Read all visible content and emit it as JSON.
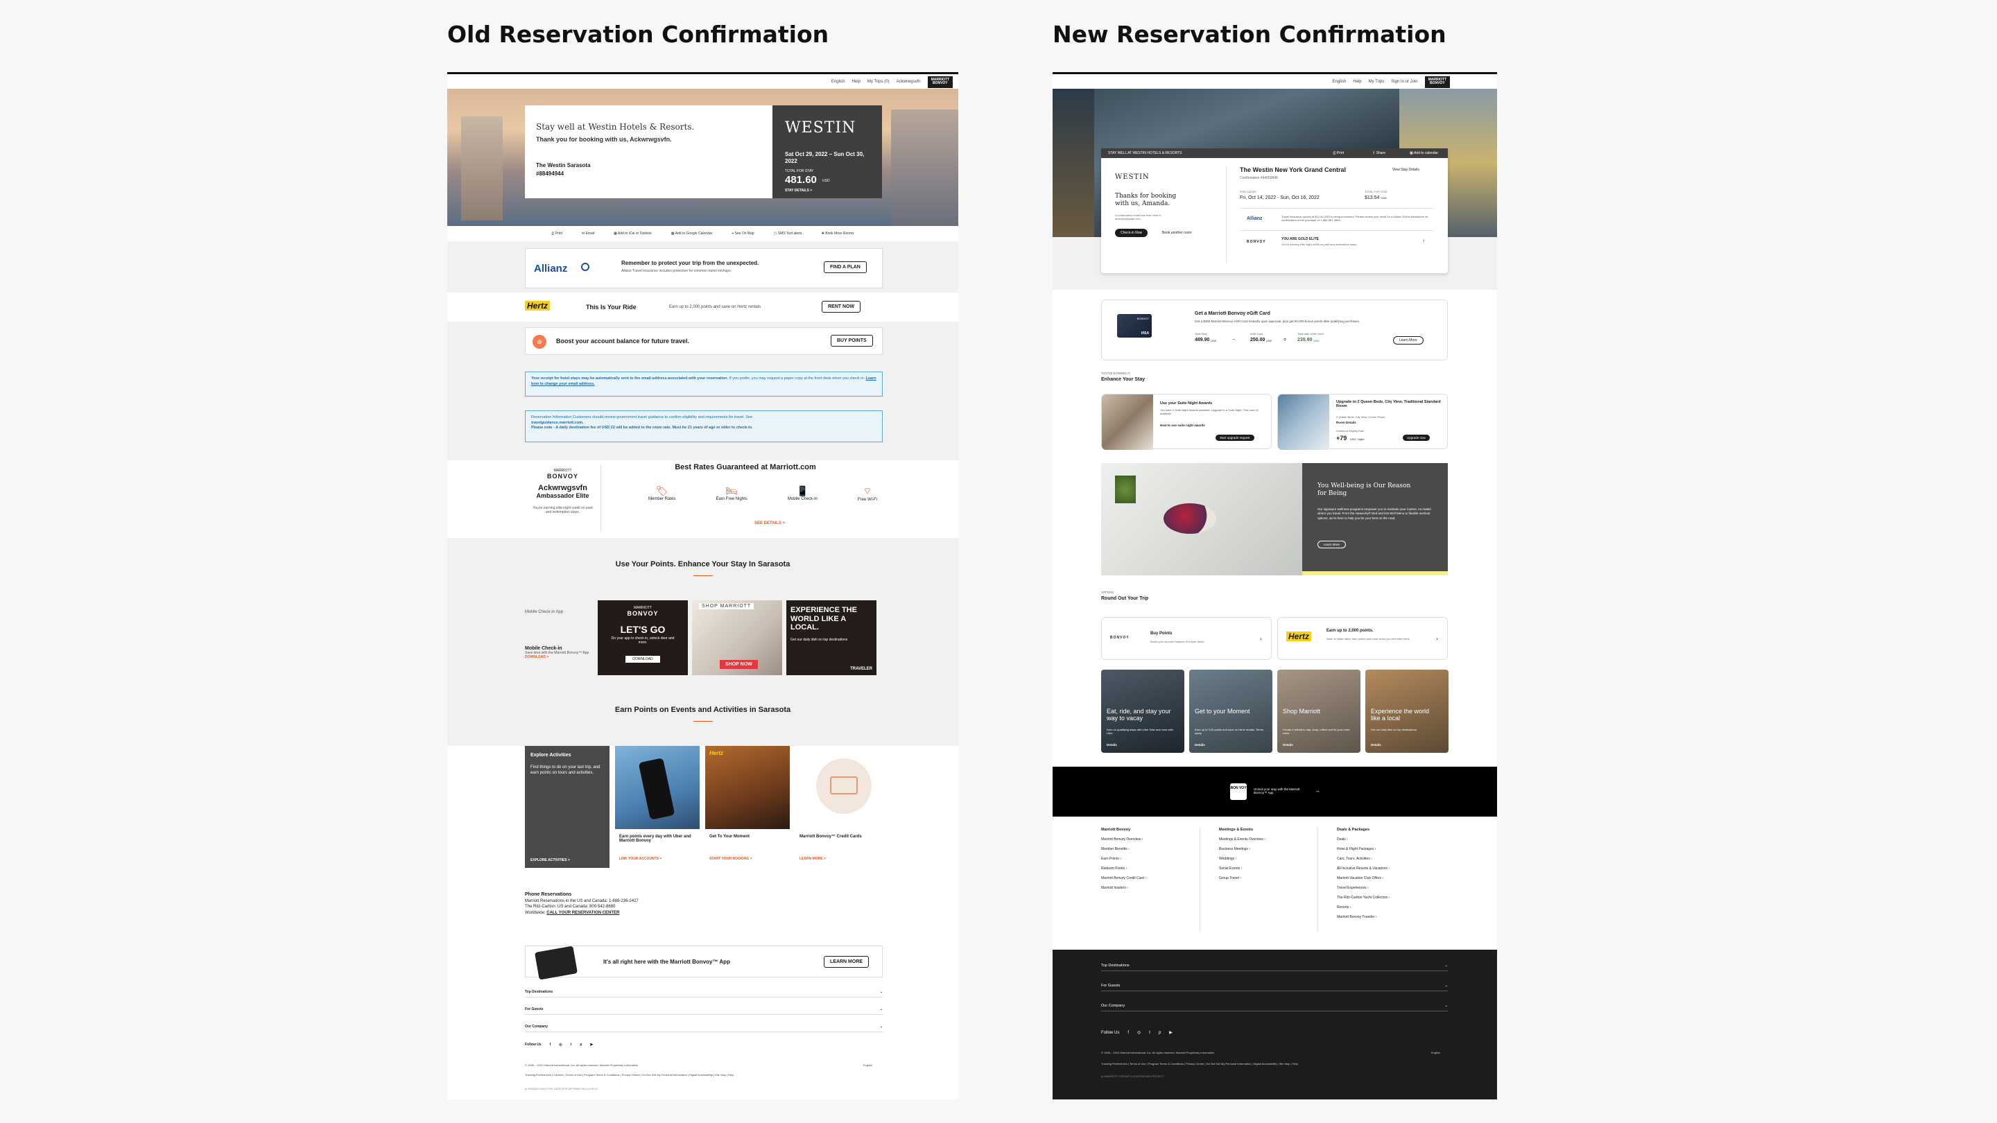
{
  "old": {
    "title": "Old Reservation Confirmation",
    "nav": {
      "items": [
        "English",
        "Help",
        "My Trips (0)",
        "Ackwrwgsvfn"
      ],
      "brand_top": "MARRIOTT",
      "brand": "BONVOY"
    },
    "hero": {
      "headline": "Stay well at Westin Hotels & Resorts.",
      "thanks": "Thank you for booking with us, Ackwrwgsvfn.",
      "hotel": "The Westin Sarasota",
      "confirmation": "#88494944",
      "logo": "WESTIN",
      "dates": "Sat Oct 29, 2022 – Sun Oct 30, 2022",
      "total_label": "TOTAL FOR STAY",
      "total": "481.60",
      "currency": "USD",
      "details_link": "STAY DETAILS >"
    },
    "actions": [
      "Print",
      "Email",
      "Add to iCal or Outlook",
      "Add to Google Calendar",
      "See On Map",
      "SMS Text alerts",
      "Book More Rooms"
    ],
    "allianz": {
      "logo": "Allianz",
      "headline": "Remember to protect your trip from the unexpected.",
      "sub": "Allianz Travel Insurance includes protection for common travel mishaps.",
      "button": "FIND A PLAN"
    },
    "hertz": {
      "logo": "Hertz",
      "headline": "This Is Your Ride",
      "sub": "Earn up to 2,000 points and save on Hertz rentals",
      "button": "RENT NOW"
    },
    "boost": {
      "headline": "Boost your account balance for future travel.",
      "button": "BUY POINTS"
    },
    "notice1": {
      "text": "Your receipt for hotel stays may be automatically sent to the email address associated with your reservation.",
      "text2": "If you prefer, you may request a paper copy at the front desk when you check in.",
      "link": "Learn how to change your email address."
    },
    "notice2": {
      "line1": "Reservation Information Customers should review government travel guidance to confirm eligibility and requirements for travel. See",
      "line2": "travelguidance.marriott.com.",
      "line3": "Please note - A daily destination fee of USD 22 will be added to the room rate. Must be 21 years of age or older to check-in."
    },
    "member": {
      "brand_top": "MARRIOTT",
      "brand": "BONVOY",
      "name": "Ackwrwgsvfn",
      "tier": "Ambassador Elite",
      "note": "You're earning elite night credit on paid and redemption stays."
    },
    "rates": {
      "title": "Best Rates Guaranteed at Marriott.com",
      "items": [
        "Member Rates",
        "Earn Free Nights",
        "Mobile Check-in",
        "Free Wi-Fi"
      ],
      "link": "SEE DETAILS >"
    },
    "points_section": {
      "title": "Use Your Points. Enhance Your Stay In Sarasota",
      "mobile_alt": "Mobile Check-in App",
      "mobile_title": "Mobile Check-in",
      "mobile_sub": "Save time with the Marriott Bonvoy™ App",
      "mobile_link": "DOWNLOAD >",
      "tile1_brand_top": "MARRIOTT",
      "tile1_brand": "BONVOY",
      "tile1_headline": "LET'S GO",
      "tile1_sub": "Do your app to check in, unlock door and more.",
      "tile1_btn": "DOWNLOAD",
      "tile2_brand": "SHOP MARRIOTT",
      "tile2_btn": "SHOP NOW",
      "tile3_headline": "EXPERIENCE THE WORLD LIKE A LOCAL.",
      "tile3_sub": "Get our daily dish on top destinations",
      "tile3_brand": "TRAVELER"
    },
    "events": {
      "title": "Earn Points on Events and Activities in Sarasota",
      "explore_title": "Explore Activities",
      "explore_sub": "Find things to do on your last trip, and earn points on tours and activities.",
      "explore_link": "EXPLORE ACTIVITIES >",
      "cards": [
        {
          "title": "Earn points every day with Uber and Marriott Bonvoy",
          "link": "LINK YOUR ACCOUNTS >"
        },
        {
          "title": "Get To Your Moment",
          "link": "START YOUR BOOKING >"
        },
        {
          "title": "Marriott Bonvoy™ Credit Cards",
          "link": "LEARN MORE >"
        }
      ],
      "hertz_logo": "Hertz"
    },
    "phone": {
      "title": "Phone Reservations",
      "line1": "Marriott Reservations in the US and Canada: 1-888-236-2427",
      "line2": "The Ritz-Carlton: US and Canada: 800-542-8680",
      "line3": "Worldwide:",
      "link": "CALL YOUR RESERVATION CENTER"
    },
    "app": {
      "text": "It's all right here with the Marriott Bonvoy™ App",
      "button": "LEARN MORE"
    },
    "footer": {
      "accordions": [
        "Top Destinations",
        "For Guests",
        "Our Company"
      ],
      "follow": "Follow Us",
      "copyright": "© 1996 – 2022 Marriott International, Inc. All rights reserved. Marriott Proprietary Information",
      "lang": "English",
      "links": "Tracking Preferences  |  Careers  |  Terms of Use  |  Program Terms & Conditions  |  Privacy Center  |  Do Not Sell My Personal Information  |  Digital Accessibility  |  Site Map  |  Help",
      "code": "pi-RJEBDCOMVKTHU-DATE-BTR-MSTRMKTMJ-m-PKV-2"
    }
  },
  "new": {
    "title": "New Reservation Confirmation",
    "nav": {
      "items": [
        "English",
        "Help",
        "My Trips",
        "Sign In or Join"
      ],
      "brand_top": "MARRIOTT",
      "brand": "BONVOY"
    },
    "hero": {
      "strip": "STAY WELL AT WESTIN HOTELS & RESORTS",
      "actions": [
        "Print",
        "Share",
        "Add to calendar"
      ],
      "logo": "WESTIN",
      "thanks": "Thanks for booking with us, Amanda.",
      "email_note": "A confirmation email has been sent to amanda@gmail.com",
      "checkin_btn": "Check-in Now",
      "book_btn": "Book another room",
      "hotel": "The Westin New York Grand Central",
      "view_details": "View Stay Details",
      "confirmation": "Confirmation #94659848",
      "dates_label": "STAY DATES",
      "dates": "Fri, Oct 14, 2022 - Sun, Oct 16, 2022",
      "total_label": "TOTAL FOR STAY",
      "total": "$13.54",
      "currency": "USD",
      "allianz": "Allianz",
      "allianz_text": "Travel insurance quoted at $12.40 USD is being processed. Please review your email for a Allianz Global Assistance for confirmation of the purchase or 1-866-587-4884.",
      "bonvoy_brand": "BONVOY",
      "gold_title": "YOU ARE GOLD ELITE",
      "gold_sub": "You're earning elite night credit on paid and redemption stays."
    },
    "egift": {
      "title": "Get a Marriott Bonvoy eGift Card",
      "sub": "Get a $350 Marriott Bonvoy eGift Card instantly upon approval, plus get 60,000 bonus points after qualifying purchases.",
      "total_label": "Total Stay",
      "total": "489.90",
      "card_label": "eGift Card",
      "card": "250.00",
      "after_label": "Total after eGift Card*",
      "after": "239.90",
      "currency": "USD",
      "button": "Learn More",
      "card_brand": "BONVOY",
      "visa": "VISA"
    },
    "enhance": {
      "eyebrow": "YOU'VE EARNED IT",
      "title": "Enhance Your Stay",
      "cards": [
        {
          "title": "Use your Suite Night Awards",
          "sub": "You have 3 Suite Night Awards available. Upgrade to a Suite Night. This room is available.",
          "link": "How to use suite night awards",
          "btn": "Start upgrade request"
        },
        {
          "title": "Upgrade to 2 Queen Beds, City View, Traditional Standard Room",
          "sub": "2 Queen Beds, City View, Corner Room",
          "link": "Room Details",
          "price_label": "Additional Nightly Rate",
          "price": "+79",
          "price_unit": "USD / night",
          "btn": "Upgrade now"
        }
      ]
    },
    "wellbeing": {
      "title": "You Well-being is Our Reason for Being",
      "sub": "Our signature wellness programs empower you to maintain your routine, no matter where you travel. From the Heavenly® Bed and Eat Well Menu to flexible workout options, we're here to help you be your best on the road.",
      "button": "Learn More"
    },
    "round": {
      "eyebrow": "OFFERS",
      "title": "Round Out Your Trip",
      "buy_brand": "BONVOY",
      "buy_title": "Buy Points",
      "buy_sub": "Boost your account balance for future travel.",
      "hertz_logo": "Hertz",
      "hertz_title": "Earn up to 2,000 points.",
      "hertz_sub": "Save on base rates, earn points and more when you rent with Hertz.",
      "tiles": [
        {
          "title": "Eat, ride, and stay your way to vacay",
          "sub": "Earn on qualifying stays with Uber Eats and more with Uber.",
          "link": "Details"
        },
        {
          "title": "Get to your Moment",
          "sub": "Earn up to 3,00 points and save on Hertz rentals. Terms apply.",
          "link": "Details"
        },
        {
          "title": "Shop Marriott",
          "sub": "Create a retreat to nap, shop, reflect and let your mind roam.",
          "link": "Details"
        },
        {
          "title": "Experience the world like a local",
          "sub": "Get our daily dish on top destinations.",
          "link": "Details"
        }
      ]
    },
    "app": {
      "brand": "BON VOY",
      "text": "Unlock your stay with the Marriott Bonvoy™ App"
    },
    "footer": {
      "cols": [
        {
          "title": "Marriott Bonvoy",
          "items": [
            "Marriott Bonvoy Overview",
            "Member Benefits",
            "Earn Points",
            "Redeem Points",
            "Marriott Bonvoy Credit Card",
            "Marriott Insiders"
          ]
        },
        {
          "title": "Meetings & Events",
          "items": [
            "Meetings & Events Overview",
            "Business Meetings",
            "Weddings",
            "Social Events",
            "Group Travel"
          ]
        },
        {
          "title": "Deals & Packages",
          "items": [
            "Deals",
            "Hotel & Flight Packages",
            "Cars, Tours, Activities",
            "All-Inclusive Resorts & Vacations",
            "Marriott Vacation Club Offers",
            "Travel Experiences",
            "The Ritz-Carlton Yacht Collection",
            "Resorts",
            "Marriott Bonvoy Traveler"
          ]
        }
      ],
      "accordions": [
        "Top Destinations",
        "For Guests",
        "Our Company"
      ],
      "follow": "Follow Us",
      "copyright": "© 1996 – 2022 Marriott International, Inc. All rights reserved. Marriott Proprietary Information",
      "lang": "English",
      "links": "Tracking Preferences  |  Terms of Use  |  Program Terms & Conditions  |  Privacy Center  |  Do Not Sell My Personal Information  |  Digital Accessibility  |  Site Map  |  Help",
      "code": "pi-MARRIOTT-GROUP-LOCATION-IND-PROJECT"
    }
  }
}
